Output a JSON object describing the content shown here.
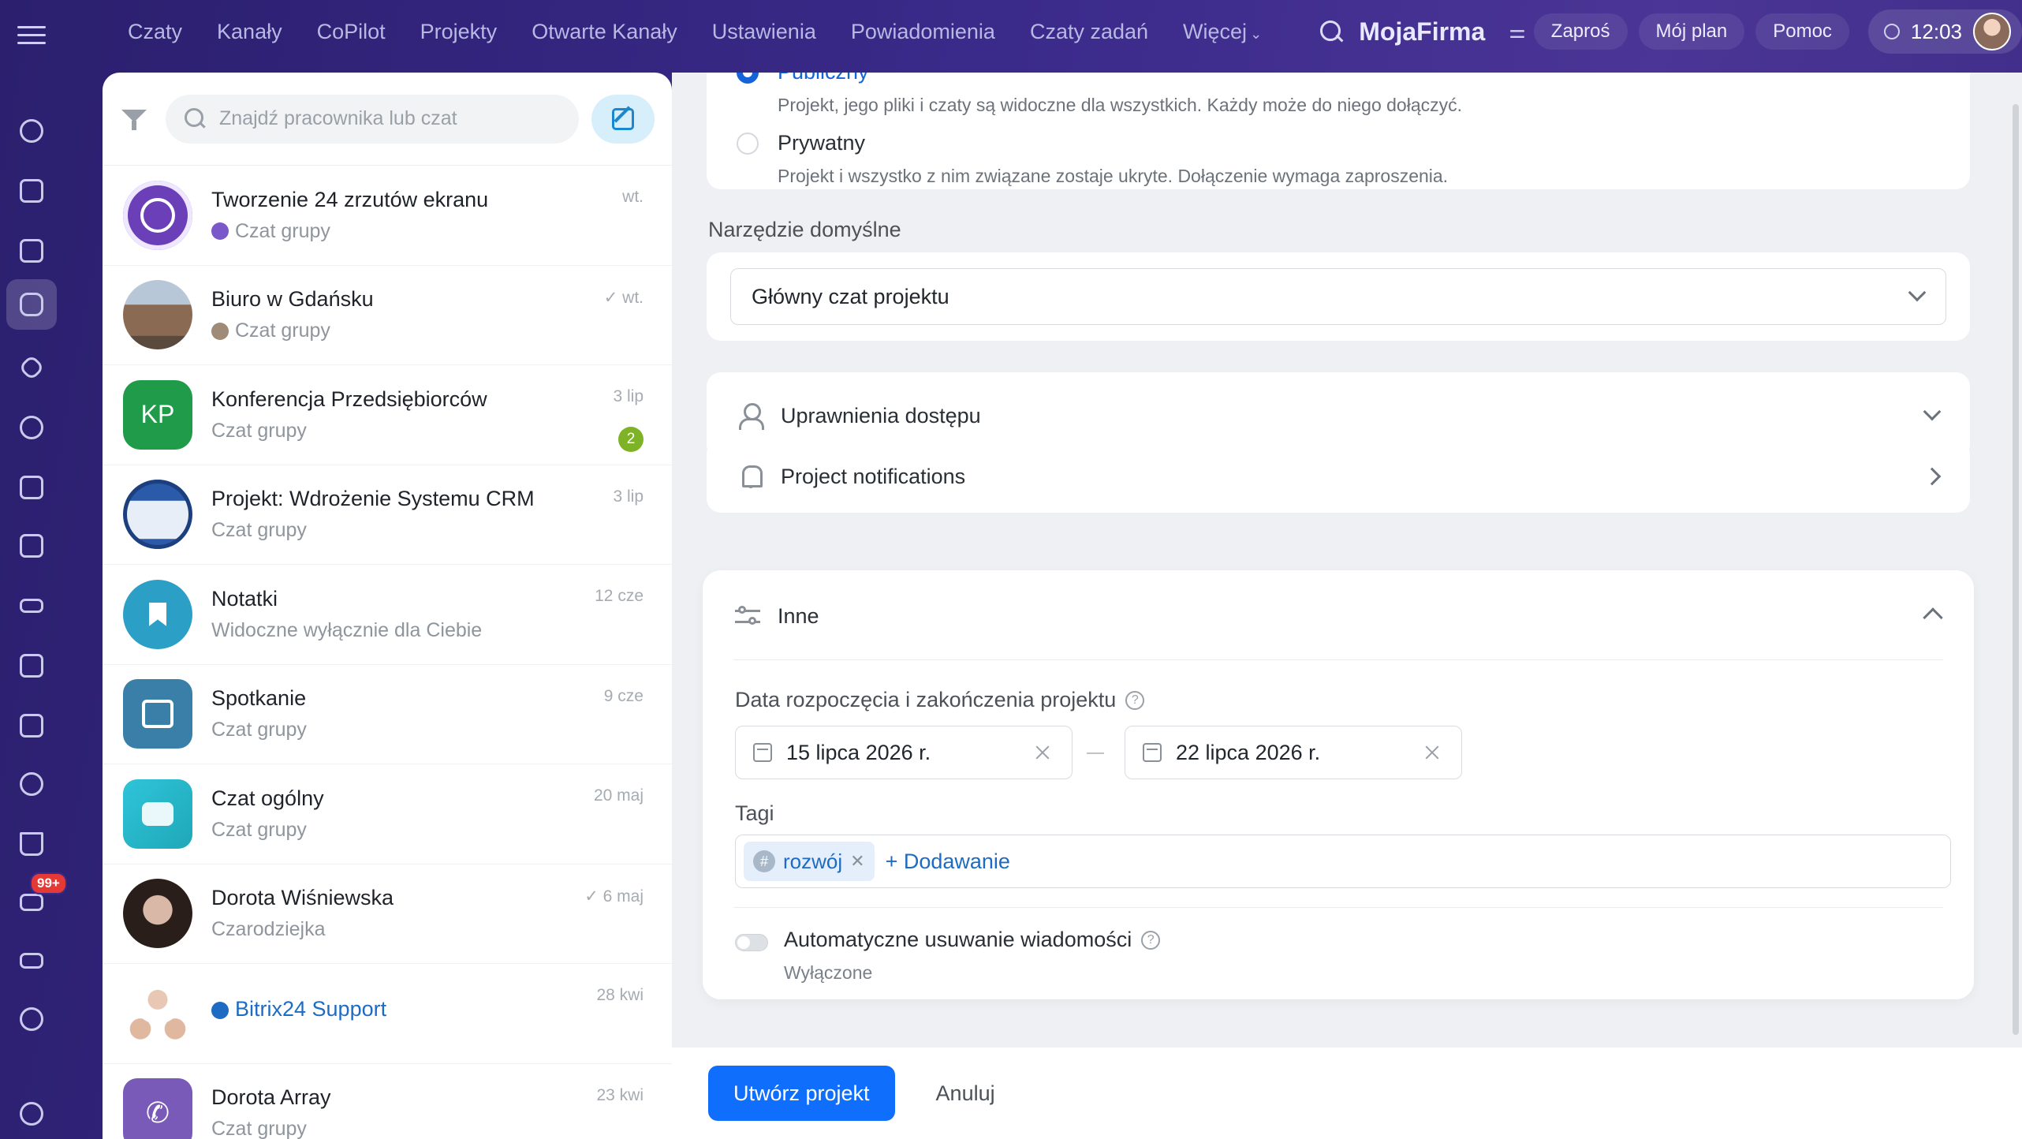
{
  "topbar": {
    "nav": [
      "Czaty",
      "Kanały",
      "CoPilot",
      "Projekty",
      "Otwarte Kanały",
      "Ustawienia",
      "Powiadomienia",
      "Czaty zadań",
      "Więcej"
    ],
    "brand": "MojaFirma",
    "invite": "Zaproś",
    "plan": "Mój plan",
    "help": "Pomoc",
    "time": "12:03"
  },
  "leftnav": {
    "icons": [
      "activity-icon",
      "feed-icon",
      "tasks-icon",
      "chats-icon",
      "copilot-icon",
      "crm-icon",
      "calendar-icon",
      "knowledge-icon",
      "drive-icon",
      "documents-icon",
      "meetings-icon",
      "sites-icon",
      "shop-icon",
      "mail-icon",
      "automation-icon",
      "goals-icon",
      "settings-icon"
    ],
    "mail_badge": "99+"
  },
  "chatlist": {
    "search_placeholder": "Znajdź pracownika lub czat",
    "items": [
      {
        "title": "Tworzenie 24 zrzutów ekranu",
        "subtitle": "Czat grupy",
        "time": "wt."
      },
      {
        "title": "Biuro w Gdańsku",
        "subtitle": "Czat grupy",
        "time": "wt."
      },
      {
        "title": "Konferencja Przedsiębiorców",
        "subtitle": "Czat grupy",
        "time": "3 lip",
        "initials": "KP",
        "count": "2"
      },
      {
        "title": "Projekt: Wdrożenie Systemu CRM",
        "subtitle": "Czat grupy",
        "time": "3 lip"
      },
      {
        "title": "Notatki",
        "subtitle": "Widoczne wyłącznie dla Ciebie",
        "time": "12 cze"
      },
      {
        "title": "Spotkanie",
        "subtitle": "Czat grupy",
        "time": "9 cze"
      },
      {
        "title": "Czat ogólny",
        "subtitle": "Czat grupy",
        "time": "20 maj"
      },
      {
        "title": "Dorota Wiśniewska",
        "subtitle": "Czarodziejka",
        "time": "6 maj"
      },
      {
        "title": "Bitrix24 Support",
        "subtitle": "",
        "time": "28 kwi"
      },
      {
        "title": "Dorota Array",
        "subtitle": "Czat grupy",
        "time": "23 kwi"
      }
    ]
  },
  "form": {
    "visibility": {
      "public_title": "Publiczny",
      "public_desc": "Projekt, jego pliki i czaty są widoczne dla wszystkich. Każdy może do niego dołączyć.",
      "private_title": "Prywatny",
      "private_desc": "Projekt i wszystko z nim związane zostaje ukryte. Dołączenie wymaga zaproszenia."
    },
    "default_tool_label": "Narzędzie domyślne",
    "default_tool_value": "Główny czat projektu",
    "permissions": "Uprawnienia dostępu",
    "notifications": "Project notifications",
    "other": {
      "title": "Inne",
      "dates_label": "Data rozpoczęcia i zakończenia projektu",
      "start_date": "15 lipca 2026 r.",
      "end_date": "22 lipca 2026 r.",
      "tags_label": "Tagi",
      "tag": "rozwój",
      "add_tag": "+ Dodawanie",
      "auto_delete_label": "Automatyczne usuwanie wiadomości",
      "auto_delete_state": "Wyłączone"
    }
  },
  "footer": {
    "create": "Utwórz projekt",
    "cancel": "Anuluj"
  },
  "colors": {
    "accent": "#0f6efb",
    "link": "#1e6bc4",
    "badge": "#7fb327"
  }
}
